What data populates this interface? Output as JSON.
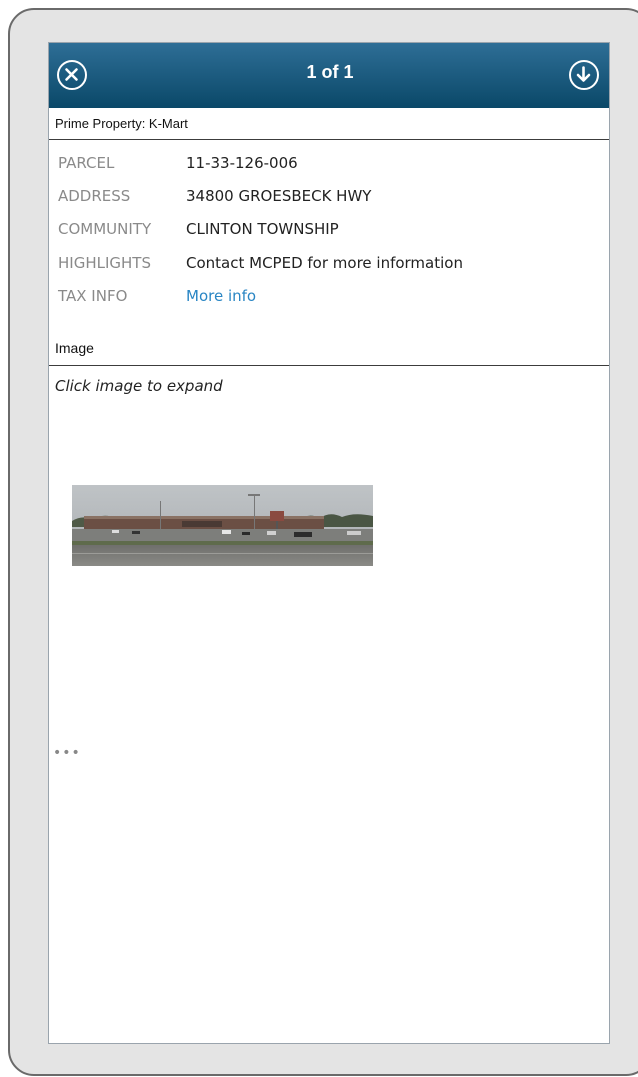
{
  "header": {
    "title": "1 of 1",
    "close_icon": "close-circle-icon",
    "download_icon": "download-circle-icon",
    "gradient_top": "#2e6e96",
    "gradient_bottom": "#0a4868"
  },
  "feature": {
    "title": "Prime Property: K-Mart"
  },
  "attributes": [
    {
      "label": "PARCEL",
      "value": "11-33-126-006"
    },
    {
      "label": "ADDRESS",
      "value": "34800 GROESBECK HWY"
    },
    {
      "label": "COMMUNITY",
      "value": "CLINTON TOWNSHIP"
    },
    {
      "label": "HIGHLIGHTS",
      "value": "Contact MCPED for more information"
    },
    {
      "label": "TAX INFO",
      "value": "More info"
    }
  ],
  "media": {
    "section_title": "Image",
    "hint": "Click image to expand",
    "thumbnail": "street-view-photo"
  },
  "footer": {
    "more_label": "•••"
  },
  "colors": {
    "link": "#2a86c4",
    "label": "#8a8a8a"
  }
}
